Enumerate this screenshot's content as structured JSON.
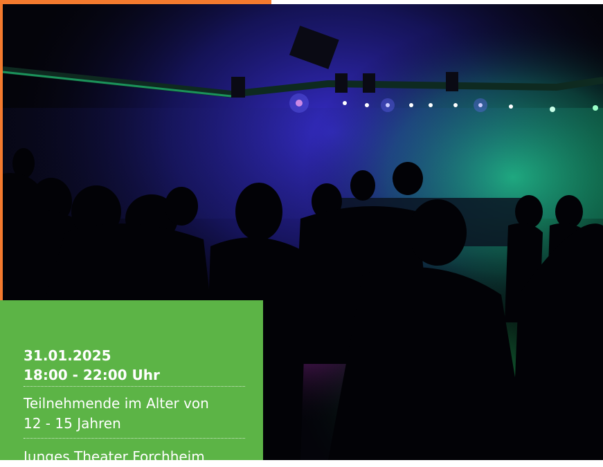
{
  "poster": {
    "accent_orange": "#f47a2e",
    "box_green": "#5cb446",
    "text_color": "#ffffff"
  },
  "photo": {
    "subject": "crowd-silhouettes-disco",
    "light_colors": [
      "#2a2ad8",
      "#16d27a",
      "#d23ad2"
    ]
  },
  "event": {
    "date": "31.01.2025",
    "time": "18:00 - 22:00 Uhr",
    "participants_line1": "Teilnehmende im Alter von",
    "participants_line2": "12 - 15 Jahren",
    "venue": "Junges Theater Forchheim"
  }
}
